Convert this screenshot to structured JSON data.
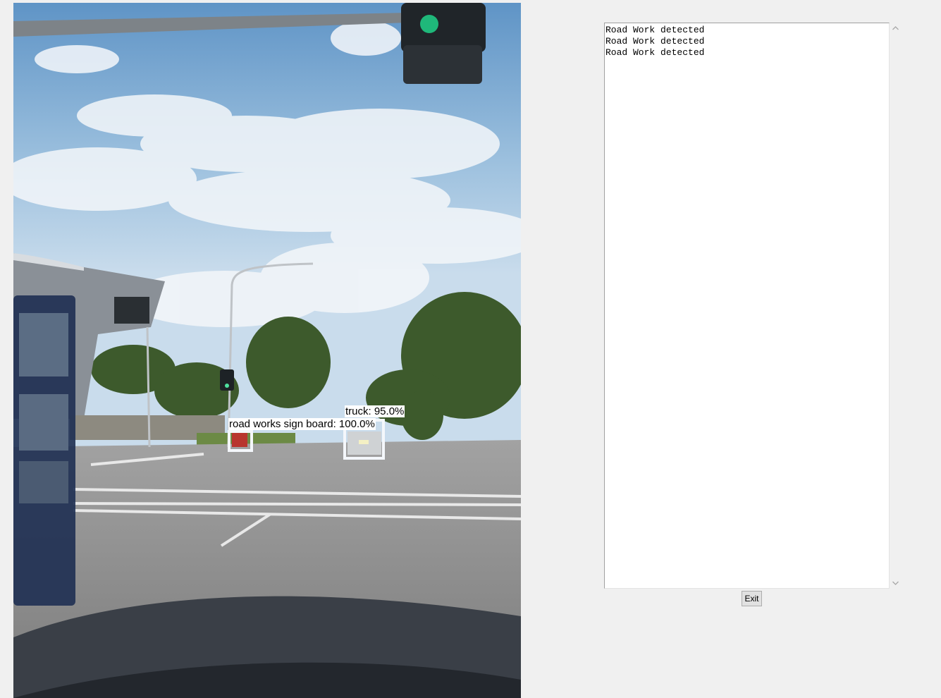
{
  "video": {
    "detections": [
      {
        "label": "truck: 95.0%"
      },
      {
        "label": "road works sign board: 100.0%"
      }
    ]
  },
  "log": {
    "lines": [
      "Road Work detected",
      "Road Work detected",
      "Road Work detected"
    ]
  },
  "scrollbar": {
    "up_icon": "chevron-up-icon",
    "down_icon": "chevron-down-icon"
  },
  "buttons": {
    "exit_label": "Exit"
  },
  "colors": {
    "window_bg": "#f0f0f0",
    "box_color": "#f4f7fb",
    "label_bg": "#ffffff"
  }
}
